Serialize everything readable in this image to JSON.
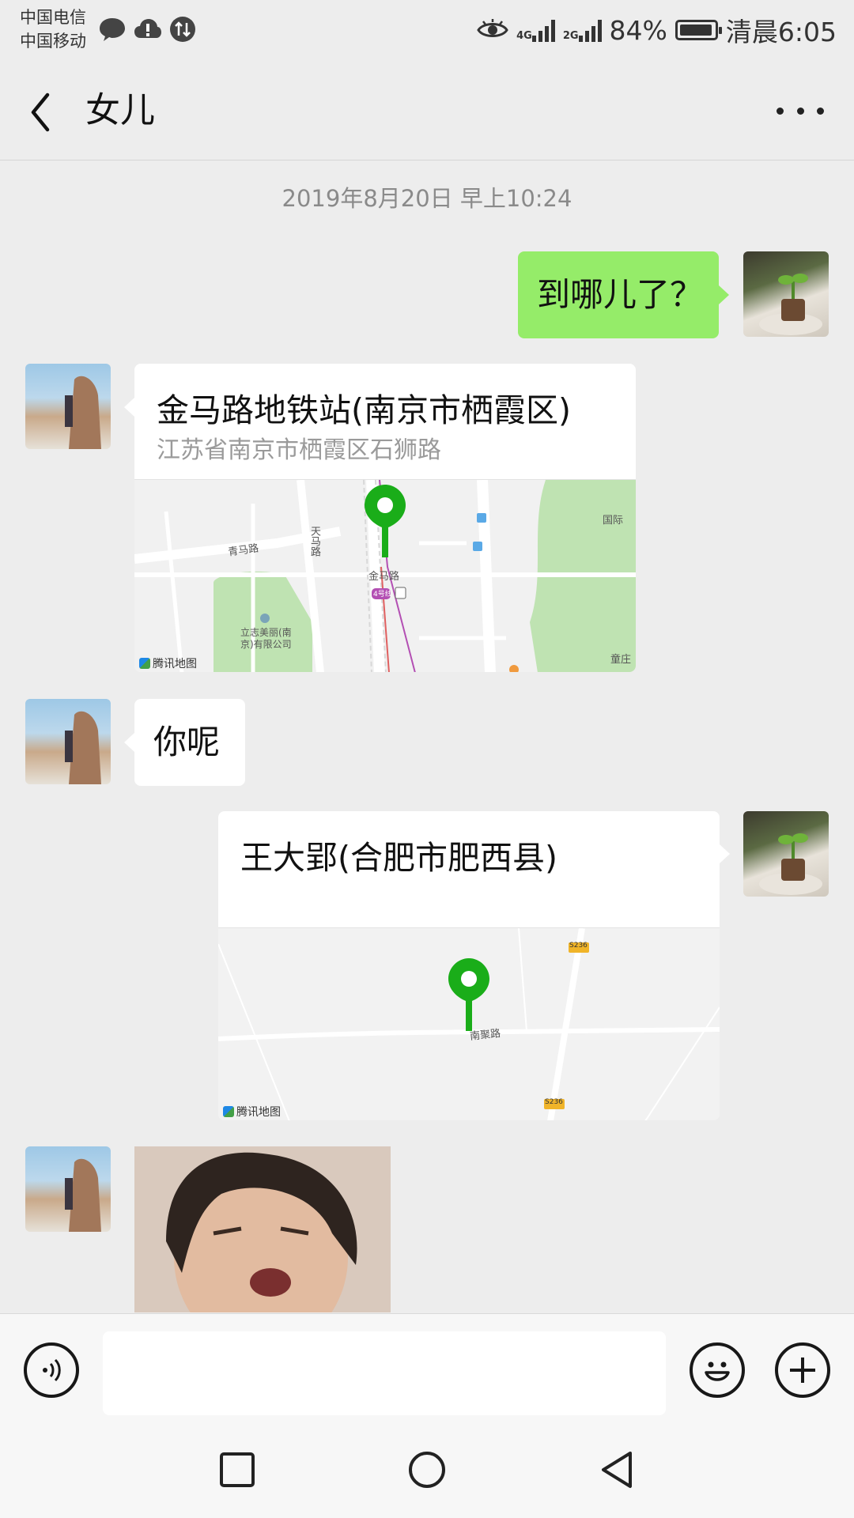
{
  "status_bar": {
    "carrier_1": "中国电信",
    "carrier_2": "中国移动",
    "net_1": "4G",
    "net_2": "2G",
    "battery": "84%",
    "time": "清晨6:05"
  },
  "header": {
    "title": "女儿"
  },
  "timestamp": "2019年8月20日 早上10:24",
  "messages": [
    {
      "from": "self",
      "type": "text",
      "text": "到哪儿了？"
    },
    {
      "from": "other",
      "type": "location",
      "name": "金马路地铁站(南京市栖霞区)",
      "address": "江苏省南京市栖霞区石狮路",
      "map_labels": [
        "青马路",
        "天马路",
        "金马路",
        "立志美丽(南京)有限公司",
        "国际",
        "童庄",
        "4号线"
      ],
      "map_logo": "腾讯地图"
    },
    {
      "from": "other",
      "type": "text",
      "text": "你呢"
    },
    {
      "from": "self",
      "type": "location",
      "name": "王大郢(合肥市肥西县)",
      "address": "",
      "map_labels": [
        "S236",
        "南聚路",
        "S236"
      ],
      "map_logo": "腾讯地图"
    },
    {
      "from": "other",
      "type": "image"
    }
  ],
  "input": {
    "value": "",
    "placeholder": ""
  },
  "colors": {
    "bubble_self": "#95ec69",
    "bubble_other": "#ffffff",
    "pin": "#1aad19",
    "background": "#ededed"
  }
}
